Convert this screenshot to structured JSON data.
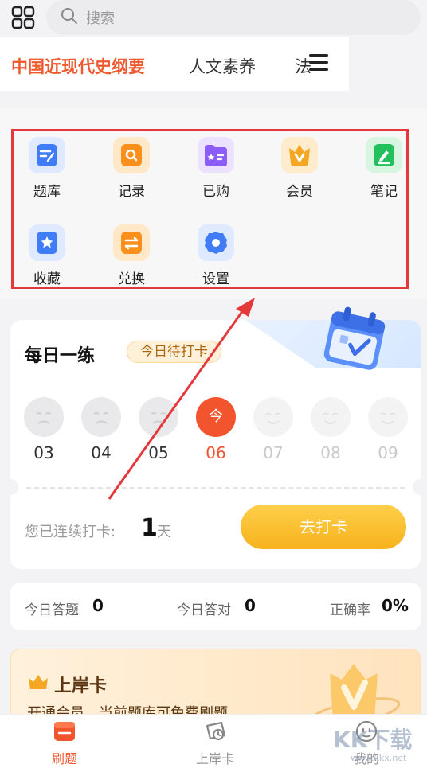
{
  "search": {
    "placeholder": "搜索"
  },
  "tabs": [
    {
      "label": "中国近现代史纲要",
      "active": true
    },
    {
      "label": "人文素养",
      "active": false
    },
    {
      "label": "法",
      "active": false
    }
  ],
  "features": [
    {
      "label": "题库",
      "icon": "question-bank-icon",
      "color": "#3f7cf6"
    },
    {
      "label": "记录",
      "icon": "record-search-icon",
      "color": "#fb8f1c"
    },
    {
      "label": "已购",
      "icon": "purchased-folder-icon",
      "color": "#8b5cf6"
    },
    {
      "label": "会员",
      "icon": "vip-crown-icon",
      "color": "#f5a623"
    },
    {
      "label": "笔记",
      "icon": "note-edit-icon",
      "color": "#22c15e"
    },
    {
      "label": "收藏",
      "icon": "star-favorite-icon",
      "color": "#3f7cf6"
    },
    {
      "label": "兑换",
      "icon": "exchange-icon",
      "color": "#fb8f1c"
    },
    {
      "label": "设置",
      "icon": "gear-icon",
      "color": "#3f7cf6"
    }
  ],
  "daily": {
    "title": "每日一练",
    "badge": "今日待打卡",
    "days": [
      {
        "num": "03",
        "state": "missed"
      },
      {
        "num": "04",
        "state": "missed"
      },
      {
        "num": "05",
        "state": "missed"
      },
      {
        "num": "06",
        "state": "today",
        "face_text": "今"
      },
      {
        "num": "07",
        "state": "future"
      },
      {
        "num": "08",
        "state": "future"
      },
      {
        "num": "09",
        "state": "future"
      }
    ],
    "streak_label": "您已连续打卡:",
    "streak_value": "1",
    "streak_unit": "天",
    "checkin_button": "去打卡"
  },
  "stats": {
    "answered_label": "今日答题",
    "answered_value": "0",
    "correct_label": "今日答对",
    "correct_value": "0",
    "accuracy_label": "正确率",
    "accuracy_value": "0%"
  },
  "promo": {
    "title": "上岸卡",
    "subtitle": "开通会员，当前题库可免费刷题"
  },
  "bottom_nav": [
    {
      "label": "刷题",
      "active": true
    },
    {
      "label": "上岸卡",
      "active": false
    },
    {
      "label": "我的",
      "active": false
    }
  ],
  "watermark": {
    "text": "KK下载",
    "sub": "www.kkx.net"
  },
  "colors": {
    "accent": "#f2542d",
    "highlight_box": "#e5383b",
    "checkin": "#f6b21d"
  }
}
